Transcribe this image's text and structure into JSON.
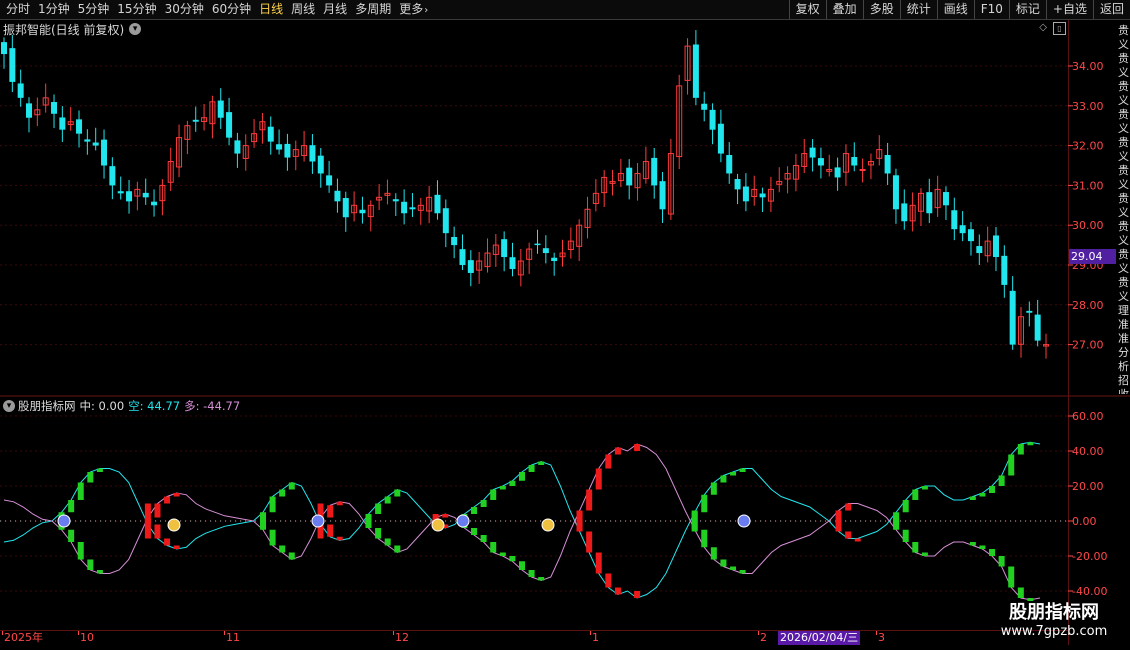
{
  "toolbar": {
    "periods": [
      "分时",
      "1分钟",
      "5分钟",
      "15分钟",
      "30分钟",
      "60分钟",
      "日线",
      "周线",
      "月线",
      "多周期",
      "更多"
    ],
    "active_period": "日线",
    "actions": [
      "复权",
      "叠加",
      "多股",
      "统计",
      "画线",
      "F10",
      "标记",
      "+自选",
      "返回"
    ]
  },
  "main_chart": {
    "title": "振邦智能(日线 前复权)",
    "price_labels": [
      "34.00",
      "33.00",
      "32.00",
      "31.00",
      "30.00",
      "29.00",
      "28.00",
      "27.00"
    ],
    "current_price_tag": "29.04",
    "up_color": "#ff3b3b",
    "down_color": "#22e6ee"
  },
  "indicator": {
    "name": "股朋指标网",
    "mid_label": "中: 0.00",
    "kong_label": "空: 44.77",
    "duo_label": "多: -44.77",
    "axis_labels": [
      "60.00",
      "40.00",
      "20.00",
      "0.00",
      "-20.00",
      "-40.00"
    ]
  },
  "dates": {
    "labels": [
      "2025年",
      "10",
      "11",
      "12",
      "1",
      "2",
      "3"
    ],
    "highlighted": "2026/02/04/三"
  },
  "watermark": {
    "title": "股朋指标网",
    "url": "www.7gpzb.com"
  },
  "side_text": "贵义贵义贵义贵义贵义贵义贵义贵义贵义贵义理准准分析招收"
}
